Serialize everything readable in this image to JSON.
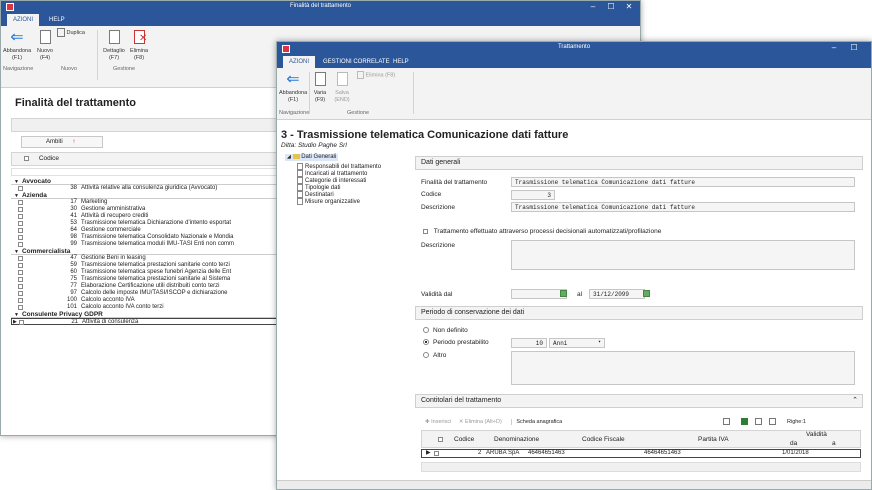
{
  "back_window": {
    "title": "Finalità del trattamento",
    "tabs": [
      "AZIONI",
      "HELP"
    ],
    "ribbon": {
      "abbandona": "Abbandona",
      "abbandona_key": "(F1)",
      "nuovo": "Nuovo",
      "nuovo_key": "(F4)",
      "duplica": "Duplica",
      "dettaglio": "Dettaglio",
      "dettaglio_key": "(F7)",
      "elimina": "Elimina",
      "elimina_key": "(F8)",
      "group_nav": "Navigazione",
      "group_nuovo": "Nuovo",
      "group_gestione": "Gestione"
    },
    "heading": "Finalità del trattamento",
    "ambiti_label": "Ambiti",
    "codice_header": "Codice",
    "groups": [
      {
        "name": "Avvocato",
        "rows": [
          {
            "code": "38",
            "desc": "Attività relative alla consulenza giuridica (Avvocato)"
          }
        ]
      },
      {
        "name": "Azienda",
        "rows": [
          {
            "code": "17",
            "desc": "Marketing"
          },
          {
            "code": "30",
            "desc": "Gestione amministrativa"
          },
          {
            "code": "41",
            "desc": "Attività di recupero crediti"
          },
          {
            "code": "53",
            "desc": "Trasmissione telematica Dichiarazione d'intento esportat"
          },
          {
            "code": "64",
            "desc": "Gestione commerciale"
          },
          {
            "code": "98",
            "desc": "Trasmissione telematica Consolidato Nazionale e Mondia"
          },
          {
            "code": "99",
            "desc": "Trasmissione telematica moduli IMU-TASI Enti non comm"
          }
        ]
      },
      {
        "name": "Commercialista",
        "rows": [
          {
            "code": "47",
            "desc": "Gestione Beni in leasing"
          },
          {
            "code": "59",
            "desc": "Trasmissione telematica prestazioni sanitarie conto terzi"
          },
          {
            "code": "60",
            "desc": "Trasmissione telematica spese funebri Agenzia delle Ent"
          },
          {
            "code": "75",
            "desc": "Trasmissione telematica prestazioni sanitarie al Sistema"
          },
          {
            "code": "77",
            "desc": "Elaborazione Certificazione utili distribuiti conto terzi"
          },
          {
            "code": "97",
            "desc": "Calcolo delle imposte IMU/TASI/ISCOP e dichiarazione"
          },
          {
            "code": "100",
            "desc": "Calcolo acconto IVA"
          },
          {
            "code": "101",
            "desc": "Calcolo acconto IVA conto terzi"
          }
        ]
      },
      {
        "name": "Consulente Privacy GDPR",
        "rows": [
          {
            "code": "21",
            "desc": "Attività di consulenza"
          }
        ]
      }
    ]
  },
  "front_window": {
    "title": "Trattamento",
    "tabs": [
      "AZIONI",
      "GESTIONI CORRELATE",
      "HELP"
    ],
    "ribbon": {
      "abbandona": "Abbandona",
      "abbandona_key": "(F1)",
      "varia": "Varia",
      "varia_key": "(F9)",
      "salva": "Salva",
      "salva_key": "(END)",
      "elimina": "Elimina (F8)",
      "group_nav": "Navigazione",
      "group_gestione": "Gestione"
    },
    "heading": "3 - Trasmissione telematica Comunicazione dati fatture",
    "subheading": "Ditta: Studio Paghe Srl",
    "tree": {
      "root": "Dati Generali",
      "children": [
        "Responsabili del trattamento",
        "Incaricati al trattamento",
        "Categorie di interessati",
        "Tipologie dati",
        "Destinatari",
        "Misure organizzative"
      ]
    },
    "dati_generali": {
      "section_title": "Dati generali",
      "finalita_label": "Finalità del trattamento",
      "finalita_value": "Trasmissione telematica Comunicazione dati fatture",
      "codice_label": "Codice",
      "codice_value": "3",
      "descrizione_label": "Descrizione",
      "descrizione_value": "Trasmissione telematica Comunicazione dati fatture",
      "automated_label": "Trattamento effettuato attraverso processi decisionali automatizzati/profilazione",
      "descrizione2_label": "Descrizione",
      "validita_label": "Validità dal",
      "al_label": "al",
      "al_value": "31/12/2099"
    },
    "conservazione": {
      "section_title": "Periodo di conservazione dei dati",
      "non_definito": "Non definito",
      "prestabilito": "Periodo prestabilito",
      "prestabilito_value": "10",
      "unit": "Anni",
      "altro": "Altro"
    },
    "contitolari": {
      "section_title": "Contitolari del trattamento",
      "inserisci": "Inserisci",
      "elimina": "Elimina (Alt+D)",
      "scheda": "Scheda anagrafica",
      "righe": "Righe:1",
      "headers": [
        "Codice",
        "Denominazione",
        "Codice Fiscale",
        "Partita IVA",
        "Validità",
        "da",
        "a"
      ],
      "rows": [
        {
          "codice": "2",
          "denominazione": "ARUBA SpA",
          "cf": "46464651463",
          "piva": "46464651463",
          "da": "1/01/2018",
          "a": ""
        }
      ]
    }
  }
}
